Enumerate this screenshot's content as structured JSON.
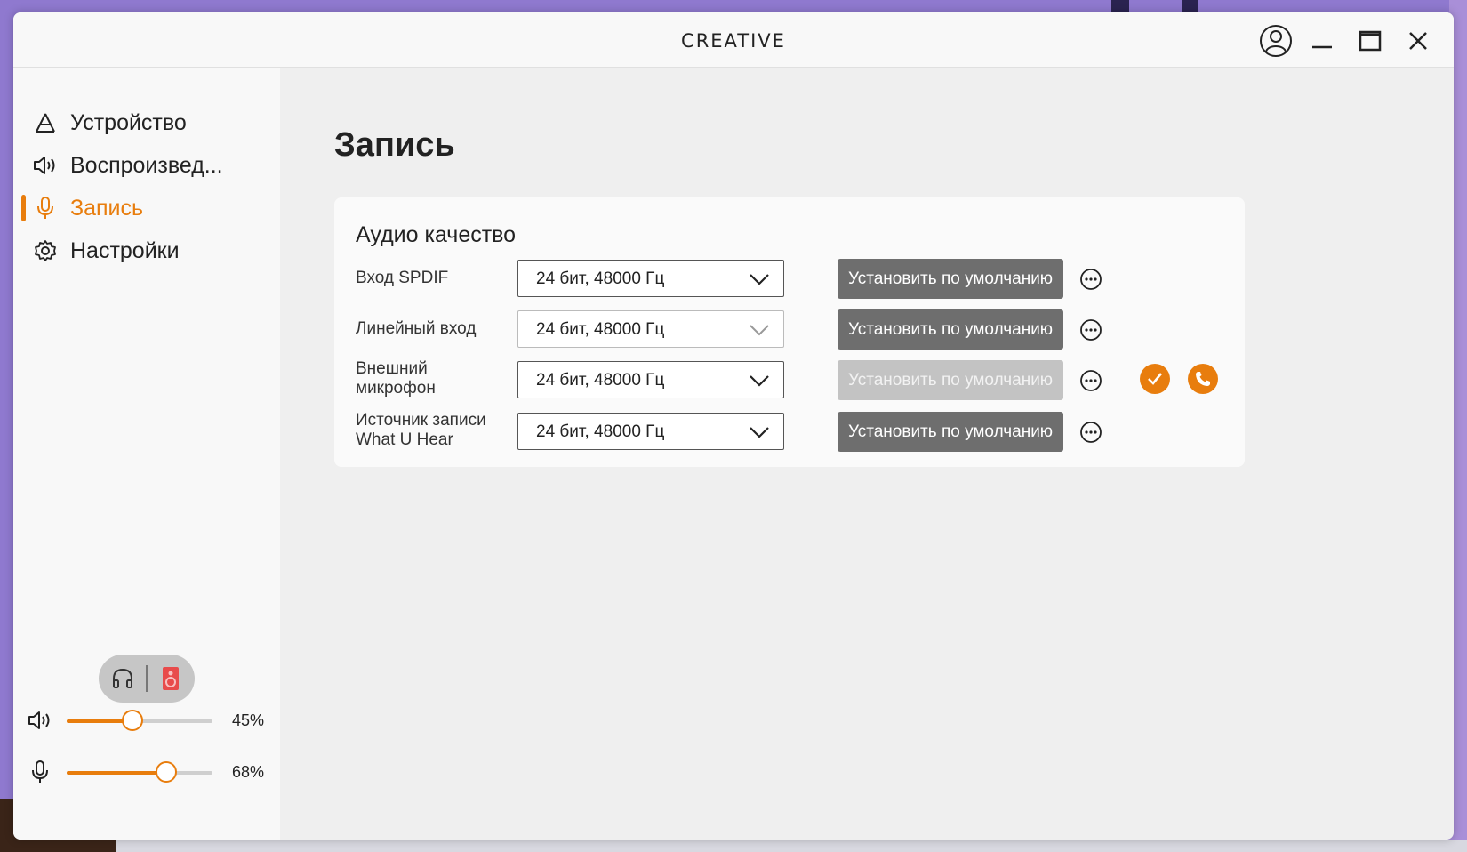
{
  "window": {
    "brand": "CREATIVE",
    "user_icon": "user-circle-icon",
    "minimize_icon": "minimize-icon",
    "maximize_icon": "maximize-icon",
    "close_icon": "close-icon"
  },
  "sidebar": {
    "items": [
      {
        "label": "Устройство",
        "icon": "device-icon",
        "active": false
      },
      {
        "label": "Воспроизвед...",
        "icon": "speaker-icon",
        "active": false
      },
      {
        "label": "Запись",
        "icon": "microphone-icon",
        "active": true
      },
      {
        "label": "Настройки",
        "icon": "gear-icon",
        "active": false
      }
    ],
    "output_toggle": {
      "left_icon": "headphones-icon",
      "right_icon": "speaker-box-icon"
    },
    "volume": {
      "playback": {
        "icon": "speaker-icon",
        "value": "45%",
        "level": 45
      },
      "recording": {
        "icon": "microphone-icon",
        "value": "68%",
        "level": 68
      }
    }
  },
  "main": {
    "title": "Запись",
    "card": {
      "title": "Аудио качество",
      "rows": [
        {
          "label_line1": "Вход SPDIF",
          "label_line2": "",
          "value": "24 бит, 48000 Гц",
          "button": "Установить по умолчанию",
          "button_enabled": true
        },
        {
          "label_line1": "Линейный вход",
          "label_line2": "",
          "value": "24 бит, 48000 Гц",
          "button": "Установить по умолчанию",
          "button_enabled": true
        },
        {
          "label_line1": "Внешний",
          "label_line2": "микрофон",
          "value": "24 бит, 48000 Гц",
          "button": "Установить по умолчанию",
          "button_enabled": false
        },
        {
          "label_line1": "Источник записи",
          "label_line2": "What U Hear",
          "value": "24 бит, 48000 Гц",
          "button": "Установить по умолчанию",
          "button_enabled": true
        }
      ],
      "status_icons": [
        "check-icon",
        "phone-icon"
      ]
    }
  },
  "colors": {
    "accent": "#e87d0d",
    "button": "#6e6e6e",
    "button_disabled": "#c3c3c3"
  }
}
